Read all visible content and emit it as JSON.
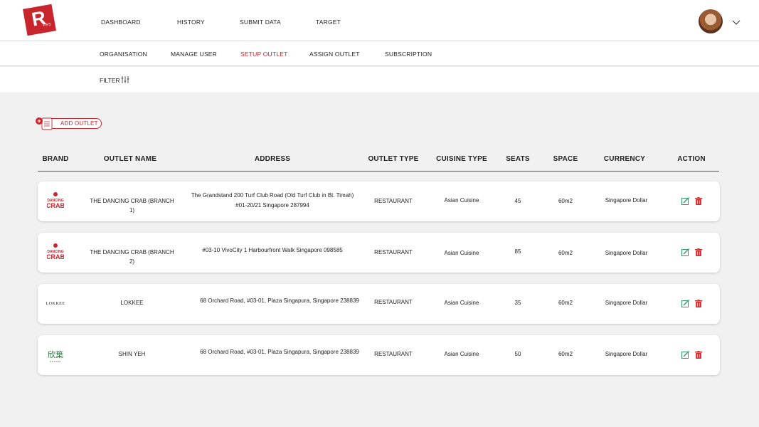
{
  "logo": {
    "letter": "R",
    "sub": "RES"
  },
  "main_nav": [
    "DASHBOARD",
    "HISTORY",
    "SUBMIT DATA",
    "TARGET"
  ],
  "sub_nav": [
    "ORGANISATION",
    "MANAGE USER",
    "SETUP OUTLET",
    "ASSIGN OUTLET",
    "SUBSCRIPTION"
  ],
  "active_sub_nav": "SETUP OUTLET",
  "filter_label": "FILTER",
  "add_outlet_label": "ADD OUTLET",
  "columns": [
    "BRAND",
    "OUTLET NAME",
    "ADDRESS",
    "OUTLET TYPE",
    "CUISINE TYPE",
    "SEATS",
    "SPACE",
    "CURRENCY",
    "ACTION"
  ],
  "rows": [
    {
      "brand_logo": "dancing-crab-logo",
      "outlet_name": "THE DANCING CRAB (BRANCH 1)",
      "address_line1": "The Grandstand 200 Turf Club Road (Old Turf Club in Bt. Timah)",
      "address_line2": "#01-20/21 Singapore 287994",
      "outlet_type": "RESTAURANT",
      "cuisine_type": "Asian Cuisine",
      "seats": "45",
      "space": "60m2",
      "currency": "Singapore Dollar"
    },
    {
      "brand_logo": "dancing-crab-logo",
      "outlet_name": "THE DANCING CRAB (BRANCH 2)",
      "address_line1": "#03-10 VivoCity 1 Harbourfront Walk Singapore 098585",
      "address_line2": "",
      "outlet_type": "RESTAURANT",
      "cuisine_type": "Asian Cuisine",
      "seats": "85",
      "space": "60m2",
      "currency": "Singapore Dollar"
    },
    {
      "brand_logo": "lokkee-logo",
      "outlet_name": "LOKKEE",
      "address_line1": "68 Orchard Road, #03-01, Plaza Singapura, Singapore 238839",
      "address_line2": "",
      "outlet_type": "RESTAURANT",
      "cuisine_type": "Asian Cuisine",
      "seats": "35",
      "space": "60m2",
      "currency": "Singapore Dollar"
    },
    {
      "brand_logo": "shin-yeh-logo",
      "outlet_name": "SHIN YEH",
      "address_line1": "68 Orchard Road, #03-01, Plaza Singapura, Singapore 238839",
      "address_line2": "",
      "outlet_type": "RESTAURANT",
      "cuisine_type": "Asian Cuisine",
      "seats": "50",
      "space": "60m2",
      "currency": "Singapore Dollar"
    }
  ],
  "logo_text": {
    "dancing_crab_top": "DANCING",
    "dancing_crab_bottom": "CRAB",
    "lokkee": "LOKKEE",
    "shin_yeh": "欣葉"
  },
  "colors": {
    "accent": "#c9252c",
    "edit": "#2e9b5e",
    "delete": "#d9262c"
  }
}
